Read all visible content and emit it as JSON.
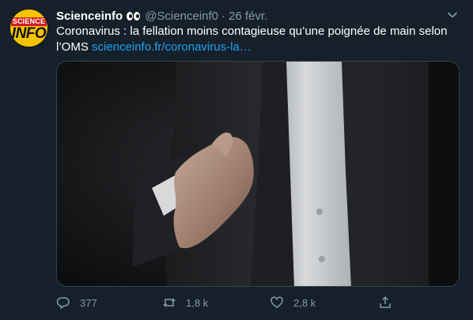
{
  "tweet": {
    "author": {
      "name": "Scienceinfo",
      "handle": "@Scienceinf0",
      "avatar_line1": "SCIENCE",
      "avatar_line2": "INFO"
    },
    "separator": "·",
    "date": "26 févr.",
    "text": "Coronavirus : la fellation moins contagieuse qu’une poignée de main selon l’OMS",
    "link": "scienceinfo.fr/coronavirus-la…",
    "stats": {
      "replies": "377",
      "retweets": "1,8 k",
      "likes": "2,8 k"
    }
  },
  "icons": {
    "more": "chevron-down-icon",
    "reply": "reply-icon",
    "retweet": "retweet-icon",
    "like": "heart-icon",
    "share": "share-icon",
    "name_emoji": "eyes-emoji-icon"
  },
  "colors": {
    "background": "#15202b",
    "text": "#ffffff",
    "muted": "#8899a6",
    "link": "#1da1f2"
  }
}
